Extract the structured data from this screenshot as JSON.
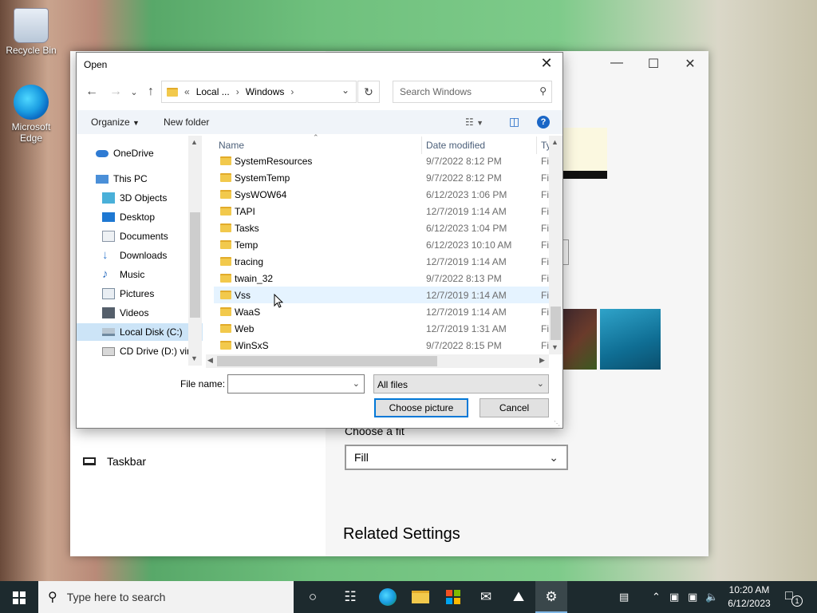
{
  "desktop": {
    "icons": [
      {
        "label": "Recycle Bin",
        "icon": "recycle-bin-icon"
      },
      {
        "label": "Microsoft Edge",
        "icon": "edge-icon"
      }
    ]
  },
  "settings": {
    "taskbar_item": "Taskbar",
    "fit_label": "Choose a fit",
    "fit_value": "Fill",
    "related_settings": "Related Settings"
  },
  "dialog": {
    "title": "Open",
    "address": {
      "prefix": "«",
      "crumb1": "Local ...",
      "crumb2": "Windows"
    },
    "search_placeholder": "Search Windows",
    "toolbar": {
      "organize": "Organize",
      "new_folder": "New folder"
    },
    "nav_items": [
      {
        "label": "OneDrive",
        "icon": "onedrive-icon",
        "color": "#2f7bd3"
      },
      {
        "label": "This PC",
        "icon": "this-pc-icon",
        "color": "#4a8fd8"
      },
      {
        "label": "3D Objects",
        "icon": "3d-objects-icon",
        "color": "#4ab0d9"
      },
      {
        "label": "Desktop",
        "icon": "desktop-icon",
        "color": "#1e78d2"
      },
      {
        "label": "Documents",
        "icon": "documents-icon",
        "color": "#8a96a6"
      },
      {
        "label": "Downloads",
        "icon": "downloads-icon",
        "color": "#3a7fd0"
      },
      {
        "label": "Music",
        "icon": "music-icon",
        "color": "#2f6fc0"
      },
      {
        "label": "Pictures",
        "icon": "pictures-icon",
        "color": "#7b8d9f"
      },
      {
        "label": "Videos",
        "icon": "videos-icon",
        "color": "#555f6b"
      },
      {
        "label": "Local Disk (C:)",
        "icon": "local-disk-icon",
        "color": "#6f8aa0"
      },
      {
        "label": "CD Drive (D:) virt",
        "icon": "cd-drive-icon",
        "color": "#8b8b8b"
      }
    ],
    "columns": {
      "name": "Name",
      "date": "Date modified",
      "type": "Ty"
    },
    "files": [
      {
        "name": "SystemResources",
        "date": "9/7/2022 8:12 PM",
        "type": "Fi"
      },
      {
        "name": "SystemTemp",
        "date": "9/7/2022 8:12 PM",
        "type": "Fi"
      },
      {
        "name": "SysWOW64",
        "date": "6/12/2023 1:06 PM",
        "type": "Fi"
      },
      {
        "name": "TAPI",
        "date": "12/7/2019 1:14 AM",
        "type": "Fi"
      },
      {
        "name": "Tasks",
        "date": "6/12/2023 1:04 PM",
        "type": "Fi"
      },
      {
        "name": "Temp",
        "date": "6/12/2023 10:10 AM",
        "type": "Fi"
      },
      {
        "name": "tracing",
        "date": "12/7/2019 1:14 AM",
        "type": "Fi"
      },
      {
        "name": "twain_32",
        "date": "9/7/2022 8:13 PM",
        "type": "Fi"
      },
      {
        "name": "Vss",
        "date": "12/7/2019 1:14 AM",
        "type": "Fi"
      },
      {
        "name": "WaaS",
        "date": "12/7/2019 1:14 AM",
        "type": "Fi"
      },
      {
        "name": "Web",
        "date": "12/7/2019 1:31 AM",
        "type": "Fi"
      },
      {
        "name": "WinSxS",
        "date": "9/7/2022 8:15 PM",
        "type": "Fi"
      }
    ],
    "file_name_label": "File name:",
    "file_name_value": "",
    "filter_value": "All files",
    "choose_button": "Choose picture",
    "cancel_button": "Cancel"
  },
  "taskbar": {
    "search_placeholder": "Type here to search",
    "clock_time": "10:20 AM",
    "clock_date": "6/12/2023",
    "notification_count": "1"
  },
  "colors": {
    "accent": "#0078d7",
    "selection": "#cce4f7",
    "hover": "#e5f3ff",
    "taskbar": "#1d2a2e"
  }
}
